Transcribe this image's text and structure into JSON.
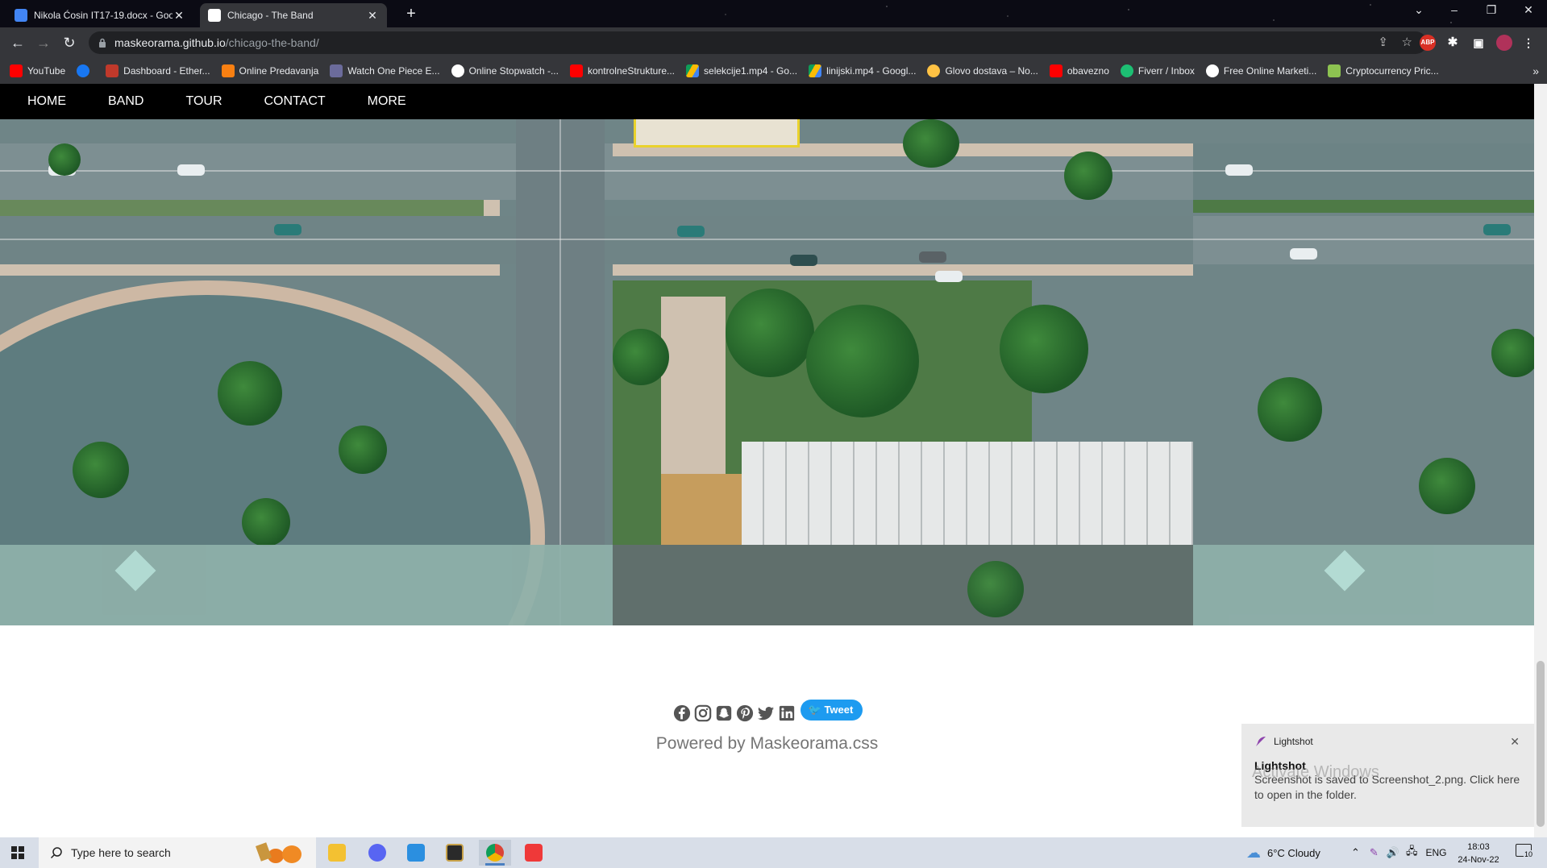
{
  "browser": {
    "tabs": [
      {
        "title": "Nikola Ćosin IT17-19.docx - Goo",
        "active": false,
        "icon": "docs-icon"
      },
      {
        "title": "Chicago - The Band",
        "active": true,
        "icon": "github-icon"
      }
    ],
    "url_host": "maskeorama.github.io",
    "url_path": "/chicago-the-band/",
    "extension_badge": "ABP",
    "bookmarks": [
      "YouTube",
      "",
      "Dashboard - Ether...",
      "Online Predavanja",
      "Watch One Piece E...",
      "Online Stopwatch -...",
      "kontrolneStrukture...",
      "selekcije1.mp4 - Go...",
      "linijski.mp4 - Googl...",
      "Glovo dostava – No...",
      "obavezno",
      "Fiverr / Inbox",
      "Free Online Marketi...",
      "Cryptocurrency Pric..."
    ]
  },
  "site": {
    "nav": [
      "HOME",
      "BAND",
      "TOUR",
      "CONTACT",
      "MORE"
    ],
    "tweet_label": "Tweet",
    "powered_by": "Powered by Maskeorama.css",
    "social_icons": [
      "facebook-icon",
      "instagram-icon",
      "snapchat-icon",
      "pinterest-icon",
      "twitter-icon",
      "linkedin-icon"
    ]
  },
  "toast": {
    "app": "Lightshot",
    "title": "Lightshot",
    "body": "Screenshot is saved to Screenshot_2.png. Click here to open in the folder.",
    "watermark": "Activate Windows"
  },
  "taskbar": {
    "search_placeholder": "Type here to search",
    "weather": "6°C  Cloudy",
    "language": "ENG",
    "time": "18:03",
    "date": "24-Nov-22",
    "notification_count": "10"
  }
}
